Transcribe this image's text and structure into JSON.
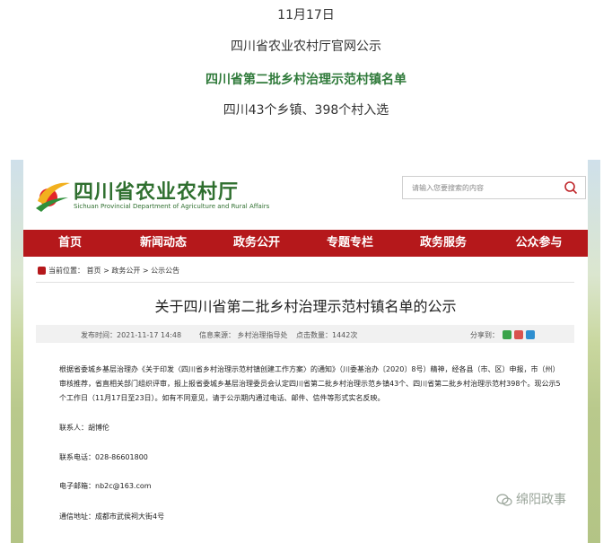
{
  "header": {
    "date": "11月17日",
    "source": "四川省农业农村厅官网公示",
    "title": "四川省第二批乡村治理示范村镇名单",
    "subtitle": "四川43个乡镇、398个村入选"
  },
  "site": {
    "logo_cn": "四川省农业农村厅",
    "logo_en": "Sichuan Provincial Department of Agriculture and Rural Affairs",
    "search_placeholder": "请输入您要搜索的内容",
    "nav": [
      "首页",
      "新闻动态",
      "政务公开",
      "专题专栏",
      "政务服务",
      "公众参与"
    ],
    "breadcrumb": "当前位置： 首页 > 政务公开 > 公示公告"
  },
  "article": {
    "title": "关于四川省第二批乡村治理示范村镇名单的公示",
    "published": "发布时间：2021-11-17 14:48",
    "source": "信息来源： 乡村治理指导处",
    "views": "点击数量：1442次",
    "share_label": "分享到：",
    "body": "根据省委城乡基层治理办《关于印发〈四川省乡村治理示范村镇创建工作方案〉的通知》（川委基治办〔2020〕8号）精神，经各县（市、区）申报，市（州）审核推荐，省直相关部门组织评审，报上报省委城乡基层治理委员会认定四川省第二批乡村治理示范乡镇43个、四川省第二批乡村治理示范村398个。现公示5个工作日（11月17日至23日）。如有不同意见，请于公示期内通过电话、邮件、信件等形式实名反映。",
    "contact": "联系人：胡博伦",
    "phone": "联系电话：028-86601800",
    "email": "电子邮箱：nb2c@163.com",
    "address": "通信地址：成都市武侯祠大街4号"
  },
  "watermark": "绵阳政事",
  "colors": {
    "nav_red": "#b5181b",
    "title_green": "#2f7a3a"
  }
}
